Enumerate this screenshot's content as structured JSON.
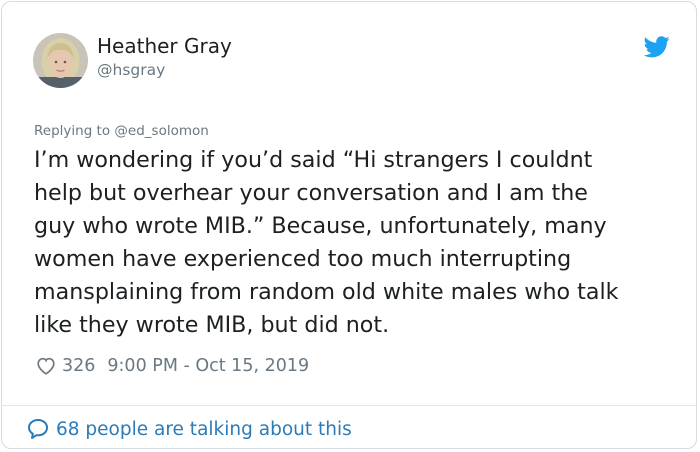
{
  "author": {
    "display_name": "Heather Gray",
    "handle": "@hsgray",
    "avatar_icon": "user-avatar"
  },
  "reply": {
    "prefix": "Replying to",
    "to_handle": "@ed_solomon"
  },
  "tweet": {
    "lines": [
      "I’m wondering if you’d said “Hi strangers I couldnt",
      "help but overhear your conversation and I am the",
      "guy who wrote MIB.” Because, unfortunately, many",
      "women have experienced too much interrupting",
      "mansplaining from random old white males who talk",
      "like they wrote MIB, but did not."
    ]
  },
  "meta": {
    "like_count": "326",
    "timestamp": "9:00 PM - Oct 15, 2019"
  },
  "conversation": {
    "label": "68 people are talking about this"
  },
  "icons": {
    "brand": "twitter-bird-icon",
    "like": "heart-icon",
    "conversation": "speech-bubble-icon"
  },
  "colors": {
    "brand": "#1da1f2",
    "link": "#2b7bb9",
    "muted": "#697882",
    "text": "#1c2022",
    "border": "#d4dbe1"
  }
}
